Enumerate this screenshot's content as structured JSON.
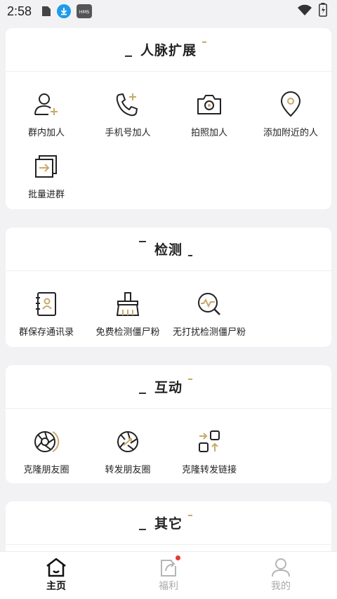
{
  "status": {
    "time": "2:58",
    "icons": [
      "sim-icon",
      "download-icon",
      "hms-icon",
      "wifi-icon",
      "battery-icon"
    ],
    "hms_label": "HMS"
  },
  "colors": {
    "accent": "#c8a96a",
    "badge": "#e53935"
  },
  "sections": [
    {
      "title": "人脉扩展",
      "items": [
        {
          "label": "群内加人",
          "icon": "person-plus-icon"
        },
        {
          "label": "手机号加人",
          "icon": "phone-plus-icon"
        },
        {
          "label": "拍照加人",
          "icon": "camera-icon"
        },
        {
          "label": "添加附近的人",
          "icon": "location-pin-icon"
        },
        {
          "label": "批量进群",
          "icon": "batch-join-icon"
        }
      ]
    },
    {
      "title": "检测",
      "items": [
        {
          "label": "群保存通讯录",
          "icon": "contact-book-icon"
        },
        {
          "label": "免费检测僵尸粉",
          "icon": "broom-icon"
        },
        {
          "label": "无打扰检测僵尸粉",
          "icon": "pulse-search-icon"
        }
      ]
    },
    {
      "title": "互动",
      "items": [
        {
          "label": "克隆朋友圈",
          "icon": "shutter-icon"
        },
        {
          "label": "转发朋友圈",
          "icon": "shutter-forward-icon"
        },
        {
          "label": "克隆转发链接",
          "icon": "link-grid-icon"
        }
      ]
    },
    {
      "title": "其它",
      "items": []
    }
  ],
  "tabbar": {
    "tabs": [
      {
        "label": "主页",
        "icon": "home-icon",
        "active": true
      },
      {
        "label": "福利",
        "icon": "share-icon",
        "active": false,
        "badge": true
      },
      {
        "label": "我的",
        "icon": "user-icon",
        "active": false
      }
    ]
  }
}
